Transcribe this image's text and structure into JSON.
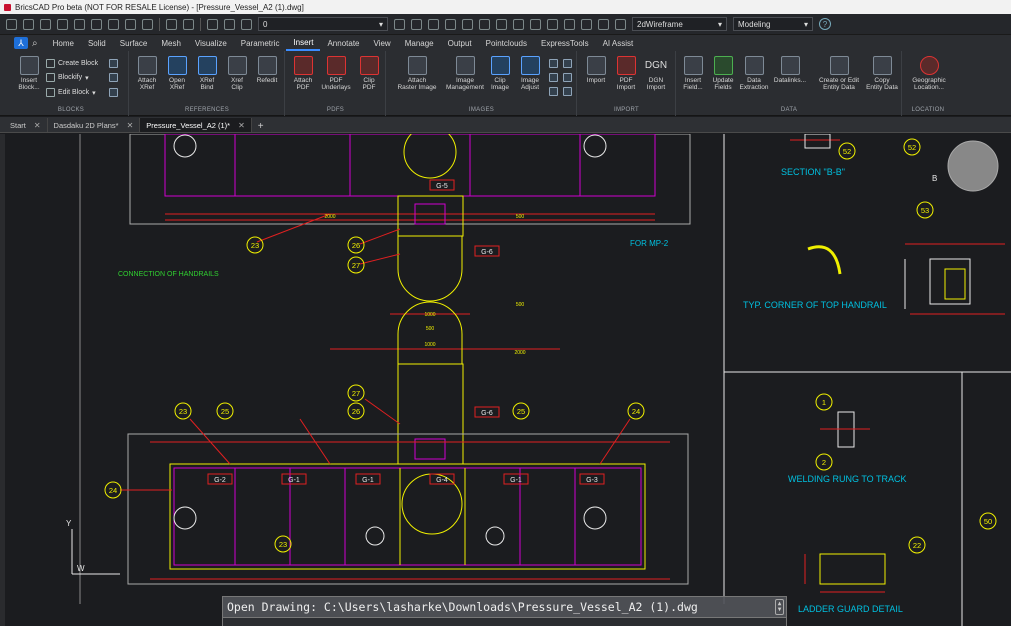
{
  "app": {
    "title": "BricsCAD Pro beta (NOT FOR RESALE License) - [Pressure_Vessel_A2 (1).dwg]"
  },
  "qat": {
    "layer_value": "0",
    "visual_style": "2dWireframe",
    "workspace": "Modeling",
    "help_glyph": "?"
  },
  "menu": {
    "app_button": "⅄",
    "search_glyph": "⌕",
    "tabs": [
      "Home",
      "Solid",
      "Surface",
      "Mesh",
      "Visualize",
      "Parametric",
      "Insert",
      "Annotate",
      "View",
      "Manage",
      "Output",
      "Pointclouds",
      "ExpressTools",
      "AI Assist"
    ],
    "active_tab": "Insert"
  },
  "ribbon": {
    "groups": {
      "blocks": "BLOCKS",
      "references": "REFERENCES",
      "pdfs": "PDFS",
      "images": "IMAGES",
      "import": "IMPORT",
      "data": "DATA",
      "location": "LOCATION"
    },
    "insert_block": "Insert\nBlock...",
    "create_block": "Create Block",
    "blockify": "Blockify",
    "edit_block": "Edit Block",
    "attach_xref": "Attach\nXRef",
    "open_xref": "Open\nXRef",
    "xref_bind": "XRef\nBind",
    "xref_clip": "Xref\nClip",
    "refedit": "Refedit",
    "attach_pdf": "Attach\nPDF",
    "pdf_underlays": "PDF\nUnderlays",
    "clip_pdf": "Clip\nPDF",
    "attach_raster": "Attach\nRaster Image",
    "image_management": "Image\nManagement",
    "clip_image": "Clip\nImage",
    "image_adjust": "Image\nAdjust",
    "import": "Import",
    "pdf_import": "PDF\nImport",
    "dgn_import": "DGN\nImport",
    "dgn_label": "DGN",
    "insert_field": "Insert\nField...",
    "update_fields": "Update\nFields",
    "data_extraction": "Data\nExtraction",
    "datalinks": "Datalinks...",
    "entity_data": "Create or Edit\nEntity Data",
    "copy_entity_data": "Copy\nEntity Data",
    "geo_location": "Geographic\nLocation..."
  },
  "doctabs": [
    {
      "label": "Start",
      "close": "✕"
    },
    {
      "label": "Dasdaku 2D Plans*",
      "close": "✕"
    },
    {
      "label": "Pressure_Vessel_A2 (1)*",
      "close": "✕"
    }
  ],
  "doctab_add": "+",
  "drawing": {
    "section_bb": "SECTION \"B-B\"",
    "for_mp": "FOR MP-2",
    "connection": "CONNECTION OF HANDRAILS",
    "corner": "TYP. CORNER OF TOP HANDRAIL",
    "welding": "WELDING RUNG TO TRACK",
    "ladder": "LADDER GUARD DETAIL",
    "g_upper": [
      "G-5",
      "G-6"
    ],
    "g_lower": [
      "G-2",
      "G-1",
      "G-1",
      "G-4",
      "G-1",
      "G-3",
      "G-6"
    ],
    "balloons": [
      "52",
      "52",
      "53",
      "23",
      "26",
      "27",
      "27",
      "26",
      "25",
      "25",
      "23",
      "24",
      "24",
      "23",
      "22",
      "50",
      "1",
      "2"
    ],
    "b_marker": "B",
    "dims": [
      "1000",
      "500",
      "500",
      "2000",
      "1000",
      "2000",
      "500"
    ],
    "axis_y": "Y",
    "axis_w": "W"
  },
  "command": {
    "text": "Open Drawing: C:\\Users\\lasharke\\Downloads\\Pressure_Vessel_A2 (1).dwg",
    "scroll_up": "▲",
    "scroll_down": "▼"
  },
  "colors": {
    "canvas": "#1b1c1f",
    "magenta": "#d000d0",
    "yellow": "#f0f000",
    "red": "#e02020",
    "cyan": "#00c0e0",
    "green": "#30d030",
    "white": "#e8e8e8",
    "accent": "#3b8cff"
  }
}
